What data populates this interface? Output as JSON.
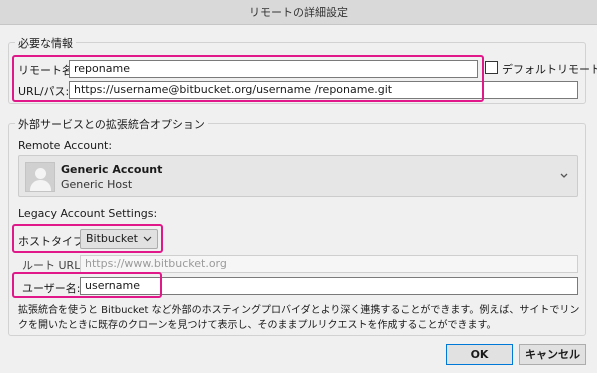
{
  "window": {
    "title": "リモートの詳細設定"
  },
  "required": {
    "group_title": "必要な情報",
    "remote_name_label": "リモート名:",
    "remote_name_value": "reponame",
    "url_label": "URL/パス:",
    "url_value": "https://username@bitbucket.org/username /reponame.git",
    "default_remote_label": "デフォルトリモート",
    "default_remote_checked": false
  },
  "integration": {
    "group_title": "外部サービスとの拡張統合オプション",
    "remote_account_label": "Remote Account:",
    "account_name": "Generic Account",
    "account_host": "Generic Host",
    "legacy_label": "Legacy Account Settings:",
    "host_type_label": "ホストタイプ:",
    "host_type_value": "Bitbucket",
    "root_url_label": "ルート URL:",
    "root_url_value": "https://www.bitbucket.org",
    "username_label": "ユーザー名:",
    "username_value": "username",
    "description": "拡張統合を使うと Bitbucket など外部のホスティングプロバイダとより深く連携することができます。例えば、サイトでリンクを開いたときに既存のクローンを見つけて表示し、そのままプルリクエストを作成することができます。"
  },
  "buttons": {
    "ok": "OK",
    "cancel": "キャンセル"
  },
  "colors": {
    "highlight": "#e0188a",
    "ok_border": "#0078d7"
  }
}
